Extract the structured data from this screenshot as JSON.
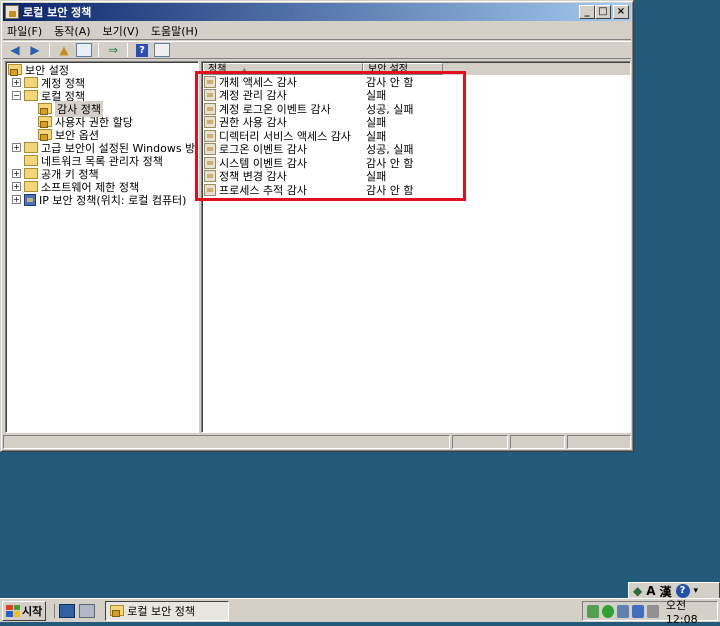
{
  "window": {
    "title": "로컬 보안 정책",
    "min": "_",
    "max": "□",
    "close": "×"
  },
  "menu": [
    "파일(F)",
    "동작(A)",
    "보기(V)",
    "도움말(H)"
  ],
  "tree": [
    {
      "label": "보안 설정",
      "indent": 0,
      "expander": "",
      "icon": "folder"
    },
    {
      "label": "계정 정책",
      "indent": 1,
      "expander": "+",
      "icon": "folder"
    },
    {
      "label": "로컬 정책",
      "indent": 1,
      "expander": "−",
      "icon": "folder"
    },
    {
      "label": "감사 정책",
      "indent": 2,
      "expander": "",
      "icon": "folder-lock",
      "selected": true
    },
    {
      "label": "사용자 권한 할당",
      "indent": 2,
      "expander": "",
      "icon": "folder-lock"
    },
    {
      "label": "보안 옵션",
      "indent": 2,
      "expander": "",
      "icon": "folder-lock"
    },
    {
      "label": "고급 보안이 설정된 Windows 방화벽",
      "indent": 1,
      "expander": "+",
      "icon": "folder"
    },
    {
      "label": "네트워크 목록 관리자 정책",
      "indent": 1,
      "expander": "",
      "icon": "folder"
    },
    {
      "label": "공개 키 정책",
      "indent": 1,
      "expander": "+",
      "icon": "folder"
    },
    {
      "label": "소프트웨어 제한 정책",
      "indent": 1,
      "expander": "+",
      "icon": "folder"
    },
    {
      "label": "IP 보안 정책(위치: 로컬 컴퓨터)",
      "indent": 1,
      "expander": "+",
      "icon": "ipsec"
    }
  ],
  "list": {
    "col_policy": "정책",
    "col_setting": "보안 설정",
    "rows": [
      {
        "policy": "개체 액세스 감사",
        "setting": "감사 안 함"
      },
      {
        "policy": "계정 관리 감사",
        "setting": "실패"
      },
      {
        "policy": "계정 로그온 이벤트 감사",
        "setting": "성공, 실패"
      },
      {
        "policy": "권한 사용 감사",
        "setting": "실패"
      },
      {
        "policy": "디렉터리 서비스 액세스 감사",
        "setting": "실패"
      },
      {
        "policy": "로그온 이벤트 감사",
        "setting": "성공, 실패"
      },
      {
        "policy": "시스템 이벤트 감사",
        "setting": "감사 안 함"
      },
      {
        "policy": "정책 변경 감사",
        "setting": "실패"
      },
      {
        "policy": "프로세스 추적 감사",
        "setting": "감사 안 함"
      }
    ]
  },
  "taskbar": {
    "start": "시작",
    "task_label": "로컬 보안 정책",
    "clock": "오전 12:08"
  },
  "langbar": {
    "ime_a": "A",
    "ime_han": "漢",
    "help": "?"
  },
  "colors": {
    "highlight": "#e0101e",
    "desktop": "#235a7a"
  }
}
